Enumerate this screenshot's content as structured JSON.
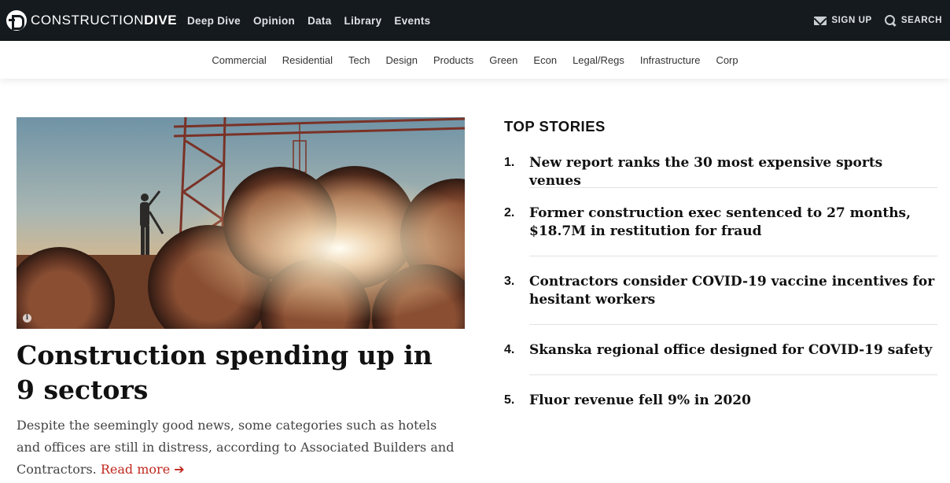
{
  "brand": {
    "name_light": "CONSTRUCTION",
    "name_bold": "DIVE"
  },
  "main_nav": [
    "Deep Dive",
    "Opinion",
    "Data",
    "Library",
    "Events"
  ],
  "utils": {
    "signup": "SIGN UP",
    "search": "SEARCH"
  },
  "sub_nav": [
    "Commercial",
    "Residential",
    "Tech",
    "Design",
    "Products",
    "Green",
    "Econ",
    "Legal/Regs",
    "Infrastructure",
    "Corp"
  ],
  "hero": {
    "info_glyph": "i",
    "headline": "Construction spending up in 9 sectors",
    "dek": "Despite the seemingly good news, some categories such as hotels and offices are still in distress, according to Associated Builders and Contractors.",
    "read_more": "Read more ➔"
  },
  "top_stories": {
    "title": "TOP STORIES",
    "items": [
      {
        "num": "1.",
        "text": "New report ranks the 30 most expensive sports venues"
      },
      {
        "num": "2.",
        "text": "Former construction exec sentenced to 27 months, $18.7M in restitution for fraud"
      },
      {
        "num": "3.",
        "text": "Contractors consider COVID-19 vaccine incentives for hesitant workers"
      },
      {
        "num": "4.",
        "text": "Skanska regional office designed for COVID-19 safety"
      },
      {
        "num": "5.",
        "text": "Fluor revenue fell 9% in 2020"
      }
    ]
  },
  "colors": {
    "topbar": "#151a1e",
    "accent": "#c0281f"
  }
}
